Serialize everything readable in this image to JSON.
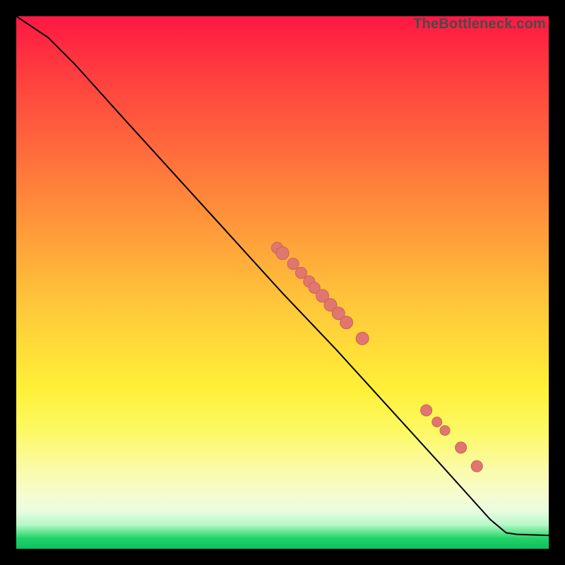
{
  "watermark": "TheBottleneck.com",
  "chart_data": {
    "type": "line",
    "title": "",
    "xlabel": "",
    "ylabel": "",
    "xlim": [
      0,
      1
    ],
    "ylim": [
      0,
      1
    ],
    "line": [
      {
        "x": 0.0,
        "y": 1.0
      },
      {
        "x": 0.06,
        "y": 0.96
      },
      {
        "x": 0.11,
        "y": 0.91
      },
      {
        "x": 0.2,
        "y": 0.81
      },
      {
        "x": 0.3,
        "y": 0.7
      },
      {
        "x": 0.4,
        "y": 0.59
      },
      {
        "x": 0.5,
        "y": 0.48
      },
      {
        "x": 0.6,
        "y": 0.375
      },
      {
        "x": 0.7,
        "y": 0.265
      },
      {
        "x": 0.8,
        "y": 0.155
      },
      {
        "x": 0.89,
        "y": 0.055
      },
      {
        "x": 0.92,
        "y": 0.03
      },
      {
        "x": 0.94,
        "y": 0.027
      },
      {
        "x": 1.0,
        "y": 0.025
      }
    ],
    "points": [
      {
        "x": 0.49,
        "y": 0.565,
        "r": 8
      },
      {
        "x": 0.5,
        "y": 0.555,
        "r": 9
      },
      {
        "x": 0.52,
        "y": 0.535,
        "r": 8
      },
      {
        "x": 0.535,
        "y": 0.518,
        "r": 8
      },
      {
        "x": 0.55,
        "y": 0.502,
        "r": 8
      },
      {
        "x": 0.56,
        "y": 0.49,
        "r": 8
      },
      {
        "x": 0.575,
        "y": 0.475,
        "r": 9
      },
      {
        "x": 0.59,
        "y": 0.458,
        "r": 9
      },
      {
        "x": 0.605,
        "y": 0.442,
        "r": 9
      },
      {
        "x": 0.62,
        "y": 0.425,
        "r": 9
      },
      {
        "x": 0.65,
        "y": 0.395,
        "r": 9
      },
      {
        "x": 0.77,
        "y": 0.26,
        "r": 8
      },
      {
        "x": 0.79,
        "y": 0.238,
        "r": 7
      },
      {
        "x": 0.805,
        "y": 0.222,
        "r": 7
      },
      {
        "x": 0.835,
        "y": 0.19,
        "r": 8
      },
      {
        "x": 0.865,
        "y": 0.155,
        "r": 8
      }
    ]
  }
}
